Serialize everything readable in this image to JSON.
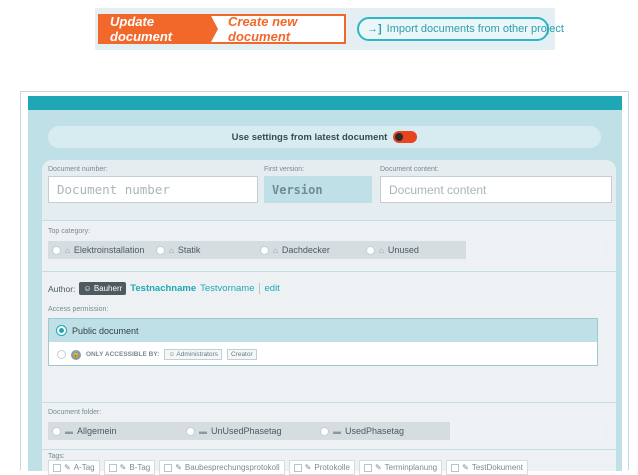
{
  "toolbar": {
    "update_label": "Update document",
    "create_label": "Create new document",
    "import_label": "Import documents from other project",
    "import_icon": "import-arrow-icon",
    "accent": "#f2682b",
    "teal": "#1fa7b5"
  },
  "form": {
    "use_latest_label": "Use settings from latest document",
    "use_latest_on": true,
    "document_number_label": "Document number:",
    "document_number_placeholder": "Document number",
    "first_version_label": "First version:",
    "first_version_placeholder": "Version",
    "document_content_label": "Document content:",
    "document_content_placeholder": "Document content",
    "top_category_label": "Top category:",
    "top_categories": [
      "Elektroinstallation",
      "Statik",
      "Dachdecker",
      "Unused"
    ],
    "author_label": "Author:",
    "author_role": "Bauherr",
    "author_lastname": "Testnachname",
    "author_firstname": "Testvorname",
    "edit_label": "edit",
    "access_label": "Access permission:",
    "access_public": "Public document",
    "access_only_label": "ONLY ACCESSIBLE BY:",
    "access_roles": [
      "Administrators",
      "Creator"
    ],
    "folder_label": "Document folder:",
    "folders": [
      "Allgemein",
      "UnUsedPhasetag",
      "UsedPhasetag"
    ],
    "tags_label": "Tags:",
    "tags": [
      "A-Tag",
      "B-Tag",
      "Baubesprechungsprotokoll",
      "Protokolle",
      "Terminplanung",
      "TestDokument"
    ]
  }
}
